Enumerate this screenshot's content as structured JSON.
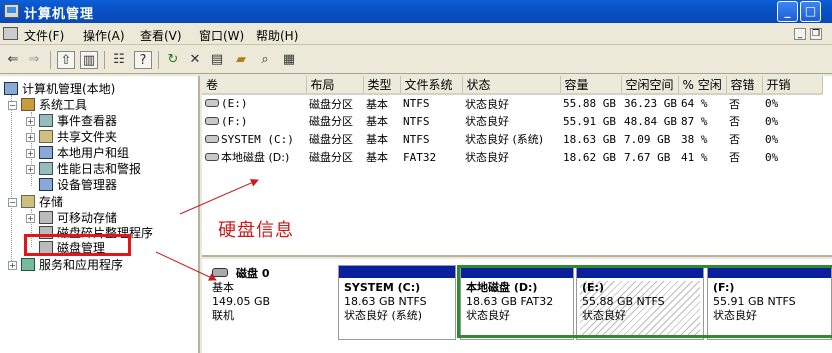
{
  "window": {
    "title": "计算机管理",
    "min": "_",
    "max": "□"
  },
  "menu": {
    "items": [
      "文件(F)",
      "操作(A)",
      "查看(V)",
      "窗口(W)",
      "帮助(H)"
    ],
    "mdi_min": "_",
    "mdi_restore": "❐"
  },
  "toolbar": {
    "icons": [
      "back-icon",
      "forward-icon",
      "up-folder-icon",
      "show-hide-tree-icon",
      "properties-icon",
      "help-icon",
      "refresh-icon",
      "delete-icon",
      "export-icon",
      "open-icon",
      "search-icon",
      "config-icon"
    ]
  },
  "tree": {
    "root": "计算机管理(本地)",
    "system_tools": "系统工具",
    "event_viewer": "事件查看器",
    "shared_folders": "共享文件夹",
    "local_users": "本地用户和组",
    "perf_logs": "性能日志和警报",
    "device_manager": "设备管理器",
    "storage": "存储",
    "removable": "可移动存储",
    "defrag": "磁盘碎片整理程序",
    "disk_mgmt": "磁盘管理",
    "services": "服务和应用程序"
  },
  "table": {
    "headers": [
      "卷",
      "布局",
      "类型",
      "文件系统",
      "状态",
      "容量",
      "空闲空间",
      "% 空闲",
      "容错",
      "开销"
    ],
    "rows": [
      [
        "(E:)",
        "磁盘分区",
        "基本",
        "NTFS",
        "状态良好",
        "55.88 GB",
        "36.23 GB",
        "64 %",
        "否",
        "0%"
      ],
      [
        "(F:)",
        "磁盘分区",
        "基本",
        "NTFS",
        "状态良好",
        "55.91 GB",
        "48.84 GB",
        "87 %",
        "否",
        "0%"
      ],
      [
        "SYSTEM (C:)",
        "磁盘分区",
        "基本",
        "NTFS",
        "状态良好 (系统)",
        "18.63 GB",
        "7.09 GB",
        "38 %",
        "否",
        "0%"
      ],
      [
        "本地磁盘 (D:)",
        "磁盘分区",
        "基本",
        "FAT32",
        "状态良好",
        "18.62 GB",
        "7.67 GB",
        "41 %",
        "否",
        "0%"
      ]
    ]
  },
  "annotation": "硬盘信息",
  "disk": {
    "name": "磁盘 0",
    "type": "基本",
    "size": "149.05 GB",
    "status": "联机",
    "partitions": [
      {
        "name": "SYSTEM  (C:)",
        "size": "18.63 GB NTFS",
        "status": "状态良好 (系统)"
      },
      {
        "name": "本地磁盘  (D:)",
        "size": "18.63 GB FAT32",
        "status": "状态良好"
      },
      {
        "name": "(E:)",
        "size": "55.88 GB NTFS",
        "status": "状态良好"
      },
      {
        "name": "(F:)",
        "size": "55.91 GB NTFS",
        "status": "状态良好"
      }
    ]
  },
  "colors": {
    "annotation": "#cc1a1a",
    "partition_bar": "#0a1f9e",
    "extended_border": "#2e8b2e",
    "titlebar": "#0a5fd8"
  }
}
